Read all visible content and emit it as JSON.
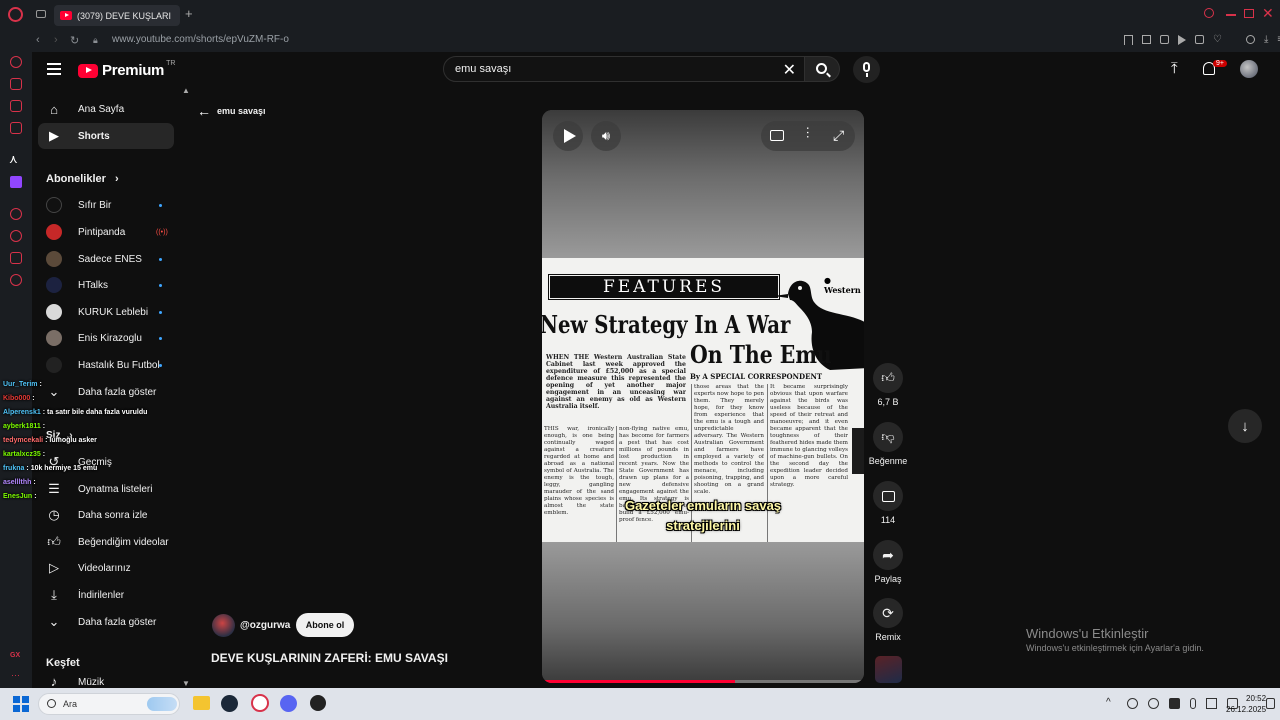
{
  "browser": {
    "tab_title": "(3079) DEVE KUŞLARI",
    "url": "www.youtube.com/shorts/epVuZM-RF-o"
  },
  "header": {
    "logo_text": "Premium",
    "logo_region": "TR",
    "search_value": "emu savaşı",
    "notification_count": "9+"
  },
  "back_nav": {
    "label": "emu savaşı"
  },
  "sidebar": {
    "main": [
      {
        "label": "Ana Sayfa",
        "icon": "home-icon"
      },
      {
        "label": "Shorts",
        "icon": "shorts-icon"
      }
    ],
    "subscriptions_header": "Abonelikler",
    "subscriptions": [
      {
        "label": "Sıfır Bir",
        "status": "new"
      },
      {
        "label": "Pintipanda",
        "status": "live"
      },
      {
        "label": "Sadece ENES",
        "status": "new"
      },
      {
        "label": "HTalks",
        "status": "new"
      },
      {
        "label": "KURUK Leblebi",
        "status": "new"
      },
      {
        "label": "Enis Kirazoglu",
        "status": "new"
      },
      {
        "label": "Hastalık Bu Futbol",
        "status": "new"
      }
    ],
    "show_more": "Daha fazla göster",
    "you_header": "Siz",
    "you_items": [
      {
        "label": "Geçmiş",
        "icon": "history-icon"
      },
      {
        "label": "Oynatma listeleri",
        "icon": "playlist-icon"
      },
      {
        "label": "Daha sonra izle",
        "icon": "clock-icon"
      },
      {
        "label": "Beğendiğim videolar",
        "icon": "thumbs-up-icon"
      },
      {
        "label": "Videolarınız",
        "icon": "video-icon"
      },
      {
        "label": "İndirilenler",
        "icon": "download-icon"
      },
      {
        "label": "Daha fazla göster",
        "icon": "chevron-down-icon"
      }
    ],
    "explore_header": "Keşfet",
    "explore_items": [
      {
        "label": "Müzik",
        "icon": "music-icon"
      }
    ]
  },
  "chat": [
    {
      "user": "Uur_Terim",
      "text": "",
      "color": "#4fc3f7"
    },
    {
      "user": "Kibo000",
      "text": "",
      "color": "#e53935"
    },
    {
      "user": "Alperensk1",
      "text": "ta satır bile daha fazla vuruldu",
      "color": "#4fc3f7"
    },
    {
      "user": "ayberk1811",
      "text": "",
      "color": "#7cfc00"
    },
    {
      "user": "tedymcekali",
      "text": "lumoğlu asker",
      "color": "#ff6b6b"
    },
    {
      "user": "kartalxcz35",
      "text": "",
      "color": "#7cfc00"
    },
    {
      "user": "frukna",
      "text": "10k hermiye 15 emu",
      "color": "#4fc3f7"
    },
    {
      "user": "aselllthh",
      "text": "",
      "color": "#b388ff"
    },
    {
      "user": "EnesJun",
      "text": "",
      "color": "#7cfc00"
    }
  ],
  "video": {
    "newspaper": {
      "banner": "FEATURES",
      "corner": "● Western",
      "headline_line1": "New Strategy In A War",
      "headline_line2": "On The Emu",
      "byline": "By A SPECIAL CORRESPONDENT",
      "col1": "WHEN THE Western Australian State Cabinet last week approved the expenditure of £52,000 as a special defence measure this represented the opening of yet another major engagement in an unceasing war against an enemy as old as Western Australia itself.",
      "col2": "THIS war, ironically enough, is one being continually waged against a creature regarded at home and abroad as a national symbol of Australia. The enemy is the tough, leggy, gangling marauder of the sand plains whose species is almost the state emblem.",
      "col3": "non-flying native emu, has become for farmers a pest that has cost millions of pounds in lost production in recent years. Now the State Government has drawn up plans for a new defensive engagement against the emu. Its strategy is based on a decision to build a £52,000 emu-proof fence.",
      "col4": "those areas that the experts now hope to pen them. They merely hope, for they know from experience that the emu is a tough and unpredictable adversary. The Western Australian Government and farmers have employed a variety of methods to control the menace, including poisoning, trapping, and shooting on a grand scale.",
      "col5": "It became surprisingly obvious that upon warfare against the birds was useless because of the speed of their retreat and manoeuvre; and it even became apparent that the toughness of their feathered hides made them immune to glancing volleys of machine-gun bullets. On the second day the expedition leader decided upon a more careful strategy."
    },
    "caption_line1": "Gazeteler emuların savaş",
    "caption_line2": "stratejilerini",
    "progress": 0.6
  },
  "actions": {
    "likes": "6,7 B",
    "dislike_label": "Beğenme",
    "comments": "114",
    "share_label": "Paylaş",
    "remix_label": "Remix"
  },
  "channel": {
    "handle": "@ozgurwa",
    "subscribe_label": "Abone ol"
  },
  "video_title": "DEVE KUŞLARININ ZAFERİ: EMU SAVAŞI",
  "watermark": {
    "line1": "Windows'u Etkinleştir",
    "line2": "Windows'u etkinleştirmek için Ayarlar'a gidin."
  },
  "taskbar": {
    "search_placeholder": "Ara",
    "time": "20:52",
    "date": "26.12.2025"
  },
  "colors": {
    "yt_red": "#ff0033",
    "bg": "#0f0f0f",
    "accent_blue": "#3ea6ff",
    "opera_red": "#d8324a"
  }
}
